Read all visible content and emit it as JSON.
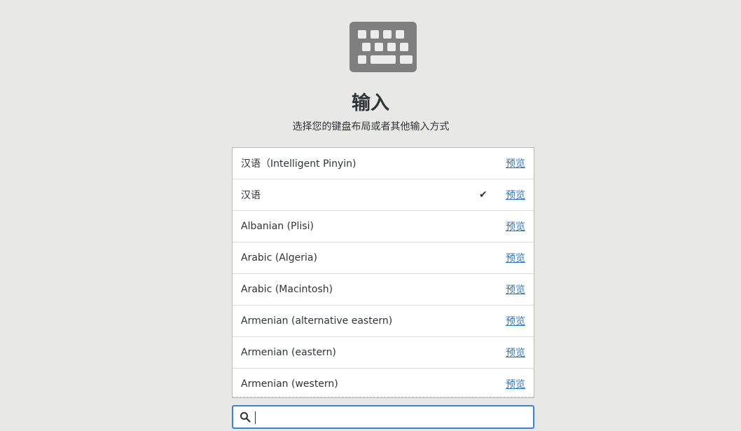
{
  "page": {
    "title": "输入",
    "subtitle": "选择您的键盘布局或者其他输入方式"
  },
  "icons": {
    "hero": "keyboard-icon",
    "check": "checkmark-icon",
    "search": "search-icon"
  },
  "colors": {
    "background": "#e8e8e7",
    "icon": "#7f7f7f",
    "link": "#2a76c6",
    "focus": "#3584e4"
  },
  "layouts": [
    {
      "label": "汉语（Intelligent Pinyin)",
      "selected": false,
      "preview": "预览"
    },
    {
      "label": "汉语",
      "selected": true,
      "check": "✔",
      "preview": "预览"
    },
    {
      "label": "Albanian (Plisi)",
      "selected": false,
      "preview": "预览"
    },
    {
      "label": "Arabic (Algeria)",
      "selected": false,
      "preview": "预览"
    },
    {
      "label": "Arabic (Macintosh)",
      "selected": false,
      "preview": "预览"
    },
    {
      "label": "Armenian (alternative eastern)",
      "selected": false,
      "preview": "预览"
    },
    {
      "label": "Armenian (eastern)",
      "selected": false,
      "preview": "预览"
    },
    {
      "label": "Armenian (western)",
      "selected": false,
      "preview": "预览"
    }
  ],
  "search": {
    "value": "",
    "placeholder": ""
  }
}
